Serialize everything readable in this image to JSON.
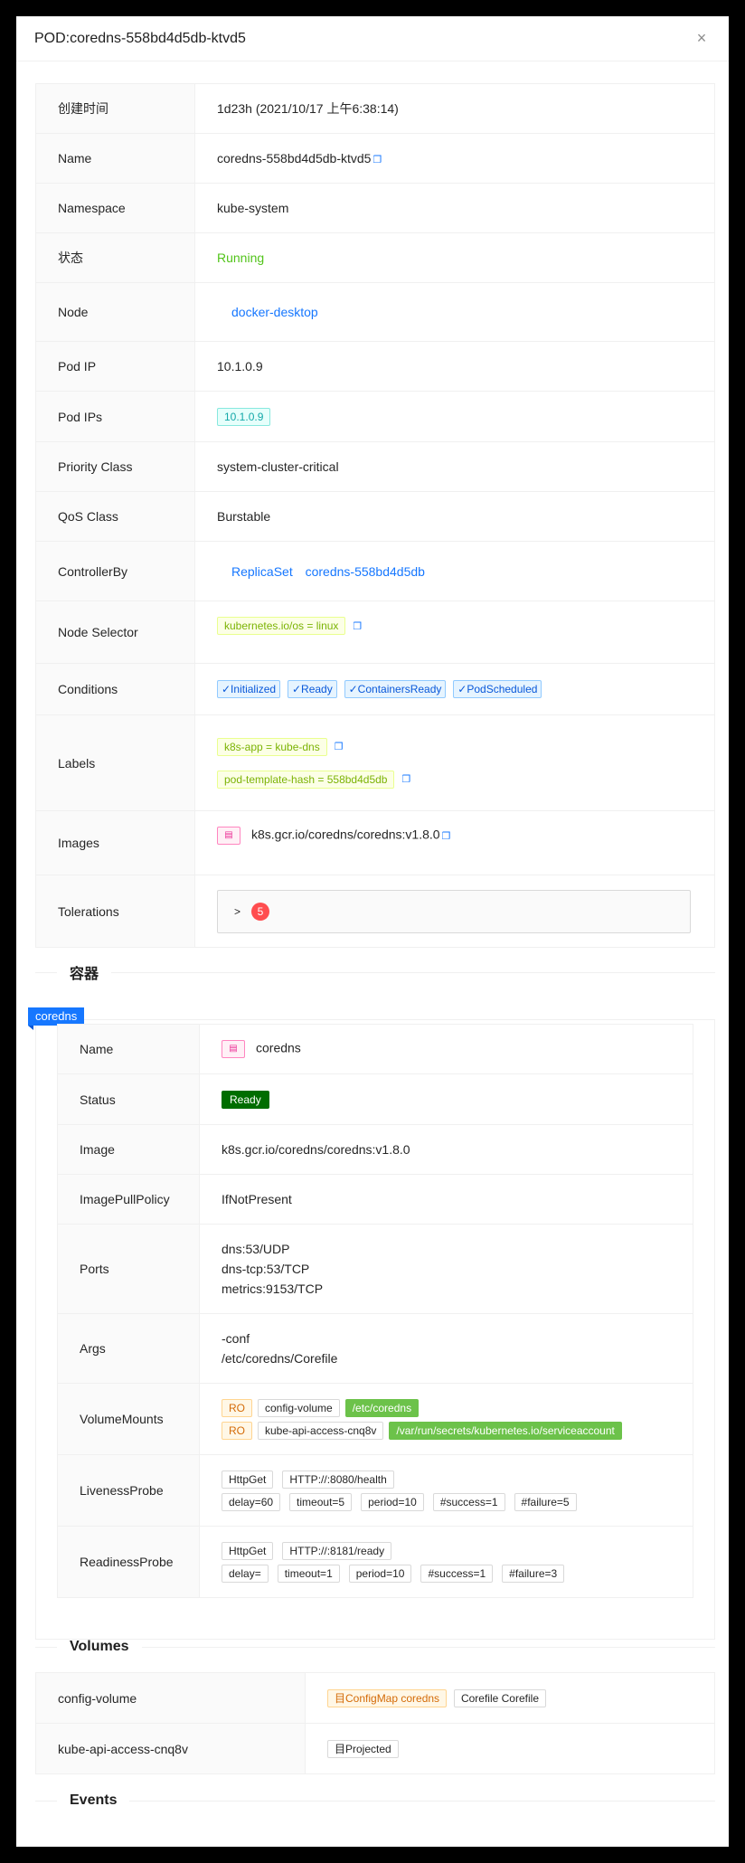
{
  "header": {
    "title": "POD:coredns-558bd4d5db-ktvd5",
    "close": "×"
  },
  "pod": {
    "created": {
      "label": "创建时间",
      "value": "1d23h (2021/10/17 上午6:38:14)"
    },
    "name": {
      "label": "Name",
      "value": "coredns-558bd4d5db-ktvd5"
    },
    "namespace": {
      "label": "Namespace",
      "value": "kube-system"
    },
    "status": {
      "label": "状态",
      "value": "Running"
    },
    "node": {
      "label": "Node",
      "value": "docker-desktop"
    },
    "pod_ip": {
      "label": "Pod IP",
      "value": "10.1.0.9"
    },
    "pod_ips": {
      "label": "Pod IPs",
      "value": "10.1.0.9"
    },
    "priority_class": {
      "label": "Priority Class",
      "value": "system-cluster-critical"
    },
    "qos_class": {
      "label": "QoS Class",
      "value": "Burstable"
    },
    "controller_by": {
      "label": "ControllerBy",
      "kind": "ReplicaSet",
      "name": "coredns-558bd4d5db"
    },
    "node_selector": {
      "label": "Node Selector",
      "value": "kubernetes.io/os = linux"
    },
    "conditions": {
      "label": "Conditions",
      "items": [
        "✓Initialized",
        "✓Ready",
        "✓ContainersReady",
        "✓PodScheduled"
      ]
    },
    "labels": {
      "label": "Labels",
      "items": [
        "k8s-app = kube-dns",
        "pod-template-hash = 558bd4d5db"
      ]
    },
    "images": {
      "label": "Images",
      "value": "k8s.gcr.io/coredns/coredns:v1.8.0"
    },
    "tolerations": {
      "label": "Tolerations",
      "arrow": ">",
      "count": "5"
    }
  },
  "containers_section": {
    "title": "容器"
  },
  "container": {
    "ribbon": "coredns",
    "name": {
      "label": "Name",
      "value": "coredns"
    },
    "status": {
      "label": "Status",
      "value": "Ready"
    },
    "image": {
      "label": "Image",
      "value": "k8s.gcr.io/coredns/coredns:v1.8.0"
    },
    "image_pull_policy": {
      "label": "ImagePullPolicy",
      "value": "IfNotPresent"
    },
    "ports": {
      "label": "Ports",
      "items": [
        "dns:53/UDP",
        "dns-tcp:53/TCP",
        "metrics:9153/TCP"
      ]
    },
    "args": {
      "label": "Args",
      "items": [
        "-conf",
        "/etc/coredns/Corefile"
      ]
    },
    "volume_mounts": {
      "label": "VolumeMounts",
      "rows": [
        {
          "mode": "RO",
          "name": "config-volume",
          "path": "/etc/coredns"
        },
        {
          "mode": "RO",
          "name": "kube-api-access-cnq8v",
          "path": "/var/run/secrets/kubernetes.io/serviceaccount"
        }
      ]
    },
    "liveness": {
      "label": "LivenessProbe",
      "row1": [
        "HttpGet",
        "HTTP://:8080/health"
      ],
      "row2": [
        "delay=60",
        "timeout=5",
        "period=10",
        "#success=1",
        "#failure=5"
      ]
    },
    "readiness": {
      "label": "ReadinessProbe",
      "row1": [
        "HttpGet",
        "HTTP://:8181/ready"
      ],
      "row2": [
        "delay=",
        "timeout=1",
        "period=10",
        "#success=1",
        "#failure=3"
      ]
    }
  },
  "volumes_section": {
    "title": "Volumes"
  },
  "volumes": [
    {
      "name": "config-volume",
      "tags": [
        "目ConfigMap coredns",
        "Corefile Corefile"
      ]
    },
    {
      "name": "kube-api-access-cnq8v",
      "tags": [
        "目Projected"
      ]
    }
  ],
  "events_section": {
    "title": "Events"
  },
  "colors": {
    "accent": "#1677ff",
    "running": "#52c41a",
    "ready": "#006d00",
    "badge": "#ff4d4f"
  },
  "icons": {
    "copy": "copy-icon",
    "image": "image-icon",
    "close": "close-icon"
  }
}
